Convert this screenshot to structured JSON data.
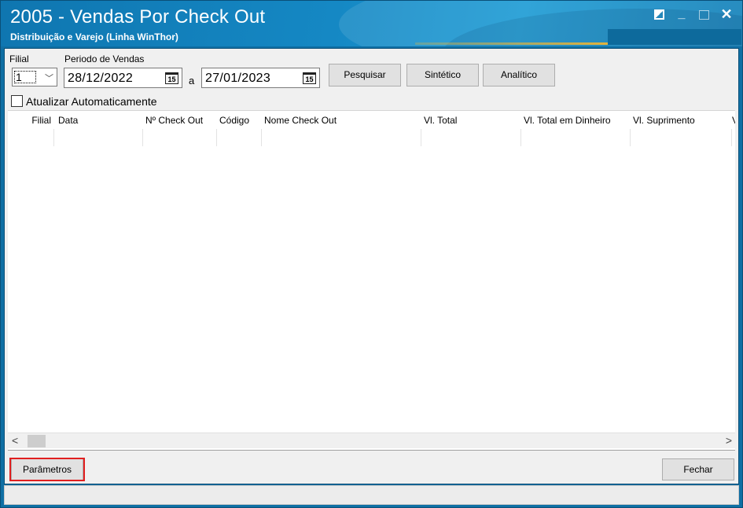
{
  "window": {
    "title": "2005 - Vendas Por Check Out",
    "subtitle": "Distribuição e Varejo (Linha WinThor)",
    "controls": {
      "restore_icon": "restore-icon",
      "minimize_glyph": "_",
      "maximize_icon": "maximize-icon",
      "close_glyph": "✕"
    }
  },
  "filters": {
    "filial_label": "Filial",
    "filial_value": "1",
    "periodo_label": "Periodo de Vendas",
    "date_from": "28/12/2022",
    "date_to": "27/01/2023",
    "date_separator": "a",
    "calendar_glyph": "15",
    "buttons": {
      "pesquisar": "Pesquisar",
      "sintetico": "Sintético",
      "analitico": "Analítico"
    },
    "auto_update_label": "Atualizar Automaticamente",
    "auto_update_checked": false
  },
  "grid": {
    "columns": [
      "Filial",
      "Data",
      "Nº Check Out",
      "Código",
      "Nome Check Out",
      "Vl. Total",
      "Vl. Total em Dinheiro",
      "Vl. Suprimento",
      "V"
    ],
    "rows": []
  },
  "scrollbar": {
    "left_arrow": "<",
    "right_arrow": ">"
  },
  "footer": {
    "parametros": "Parâmetros",
    "fechar": "Fechar"
  },
  "colors": {
    "title_bg": "#1588c4",
    "highlight_outline": "#e11f1f",
    "gold_accent": "#e2b23c"
  }
}
